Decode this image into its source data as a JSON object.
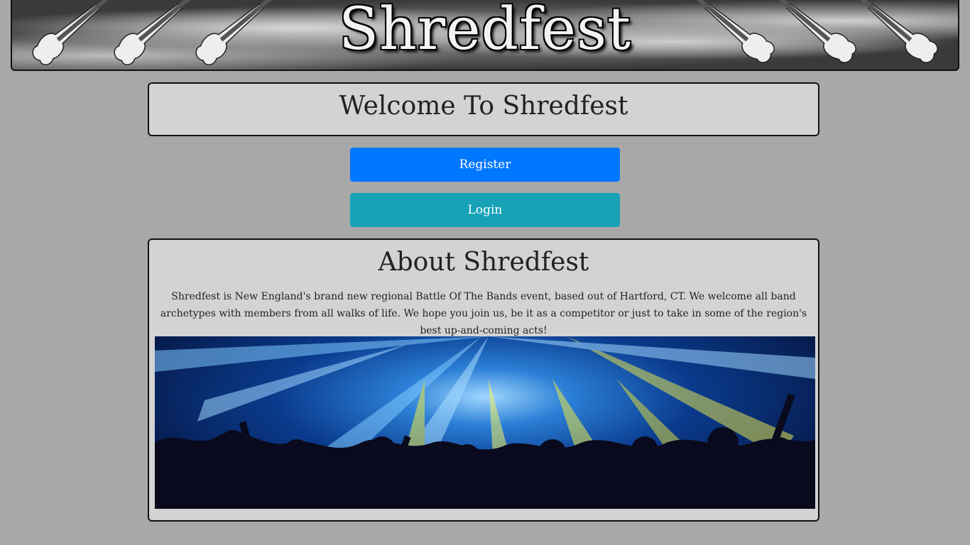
{
  "banner": {
    "title": "Shredfest",
    "image": "guitar-banner"
  },
  "welcome": {
    "heading": "Welcome To Shredfest"
  },
  "actions": {
    "register_label": "Register",
    "login_label": "Login"
  },
  "about": {
    "heading": "About Shredfest",
    "body": "Shredfest is New England's brand new regional Battle Of The Bands event, based out of Hartford, CT. We welcome all band archetypes with members from all walks of life. We hope you join us, be it as a competitor or just to take in some of the region's best up-and-coming acts!",
    "image": "concert-crowd-photo"
  },
  "colors": {
    "page_background": "#a8a8a8",
    "card_background": "#d3d3d3",
    "register_button": "#0077ff",
    "login_button": "#17a2b8"
  }
}
